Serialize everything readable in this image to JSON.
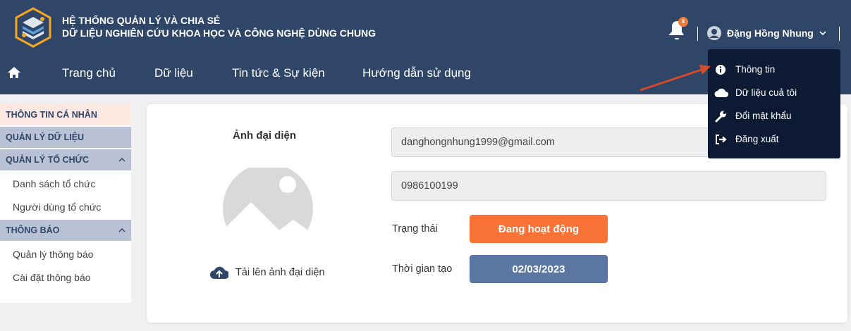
{
  "colors": {
    "header_bg": "#2f4668",
    "dropdown_bg": "#0d1a33",
    "accent_orange": "#f97236",
    "date_bg": "#5a76a2",
    "sidebar_active": "#fde9e2",
    "sidebar_group": "#b8c2d4"
  },
  "header": {
    "title_line1": "HỆ THỐNG QUẢN LÝ VÀ CHIA SẺ",
    "title_line2": "DỮ LIỆU NGHIÊN CỨU KHOA HỌC VÀ CÔNG NGHỆ DÙNG CHUNG",
    "notification_count": "8",
    "user_name": "Đặng Hồng Nhung"
  },
  "nav": {
    "home_icon": "home-icon",
    "items": [
      "Trang chủ",
      "Dữ liệu",
      "Tin tức & Sự kiện",
      "Hướng dẫn sử dụng"
    ]
  },
  "user_menu": {
    "items": [
      {
        "label": "Thông tin",
        "icon": "info-circle-icon"
      },
      {
        "label": "Dữ liệu cuả tôi",
        "icon": "cloud-icon"
      },
      {
        "label": "Đổi mật khẩu",
        "icon": "wrench-icon"
      },
      {
        "label": "Đăng xuất",
        "icon": "sign-out-icon"
      }
    ]
  },
  "sidebar": {
    "personal_info": "THÔNG TIN CÁ NHÂN",
    "data_management": "QUẢN LÝ DỮ LIỆU",
    "org_management": "QUẢN LÝ TỔ CHỨC",
    "org_items": [
      "Danh sách tổ chức",
      "Người dùng tổ chức"
    ],
    "notifications": "THÔNG BÁO",
    "notification_items": [
      "Quản lý thông báo",
      "Cài đặt thông báo"
    ]
  },
  "profile": {
    "avatar_label": "Ảnh đại diện",
    "upload_label": "Tải lên ảnh đại diện",
    "email": "danghongnhung1999@gmail.com",
    "phone": "0986100199",
    "status_label": "Trạng thái",
    "status_value": "Đang hoạt động",
    "created_label": "Thời gian tạo",
    "created_value": "02/03/2023"
  }
}
